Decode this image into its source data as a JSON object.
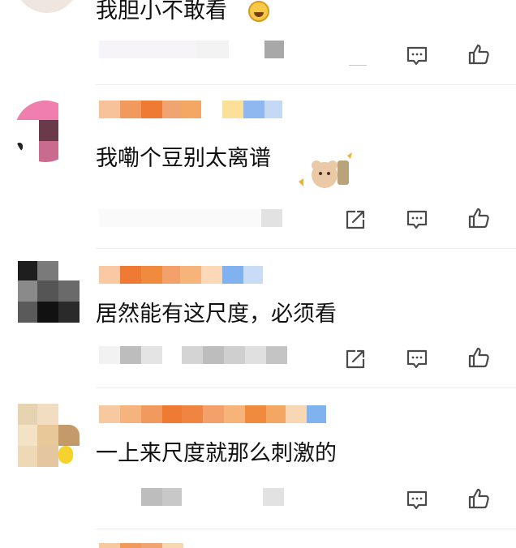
{
  "comments": [
    {
      "text": "我胆小不敢看"
    },
    {
      "text": "我嘞个豆别太离谱"
    },
    {
      "text": "居然能有这尺度，必须看"
    },
    {
      "text": "一上来尺度就那么刺激的"
    }
  ],
  "icons": {
    "share": "share-icon",
    "reply": "comment-icon",
    "like": "thumbs-up-icon"
  },
  "colors": {
    "icon_stroke": "#4a4a4a",
    "divider": "#ececec",
    "name_orange": "#f08a3c",
    "name_blue": "#7fb2ee"
  }
}
